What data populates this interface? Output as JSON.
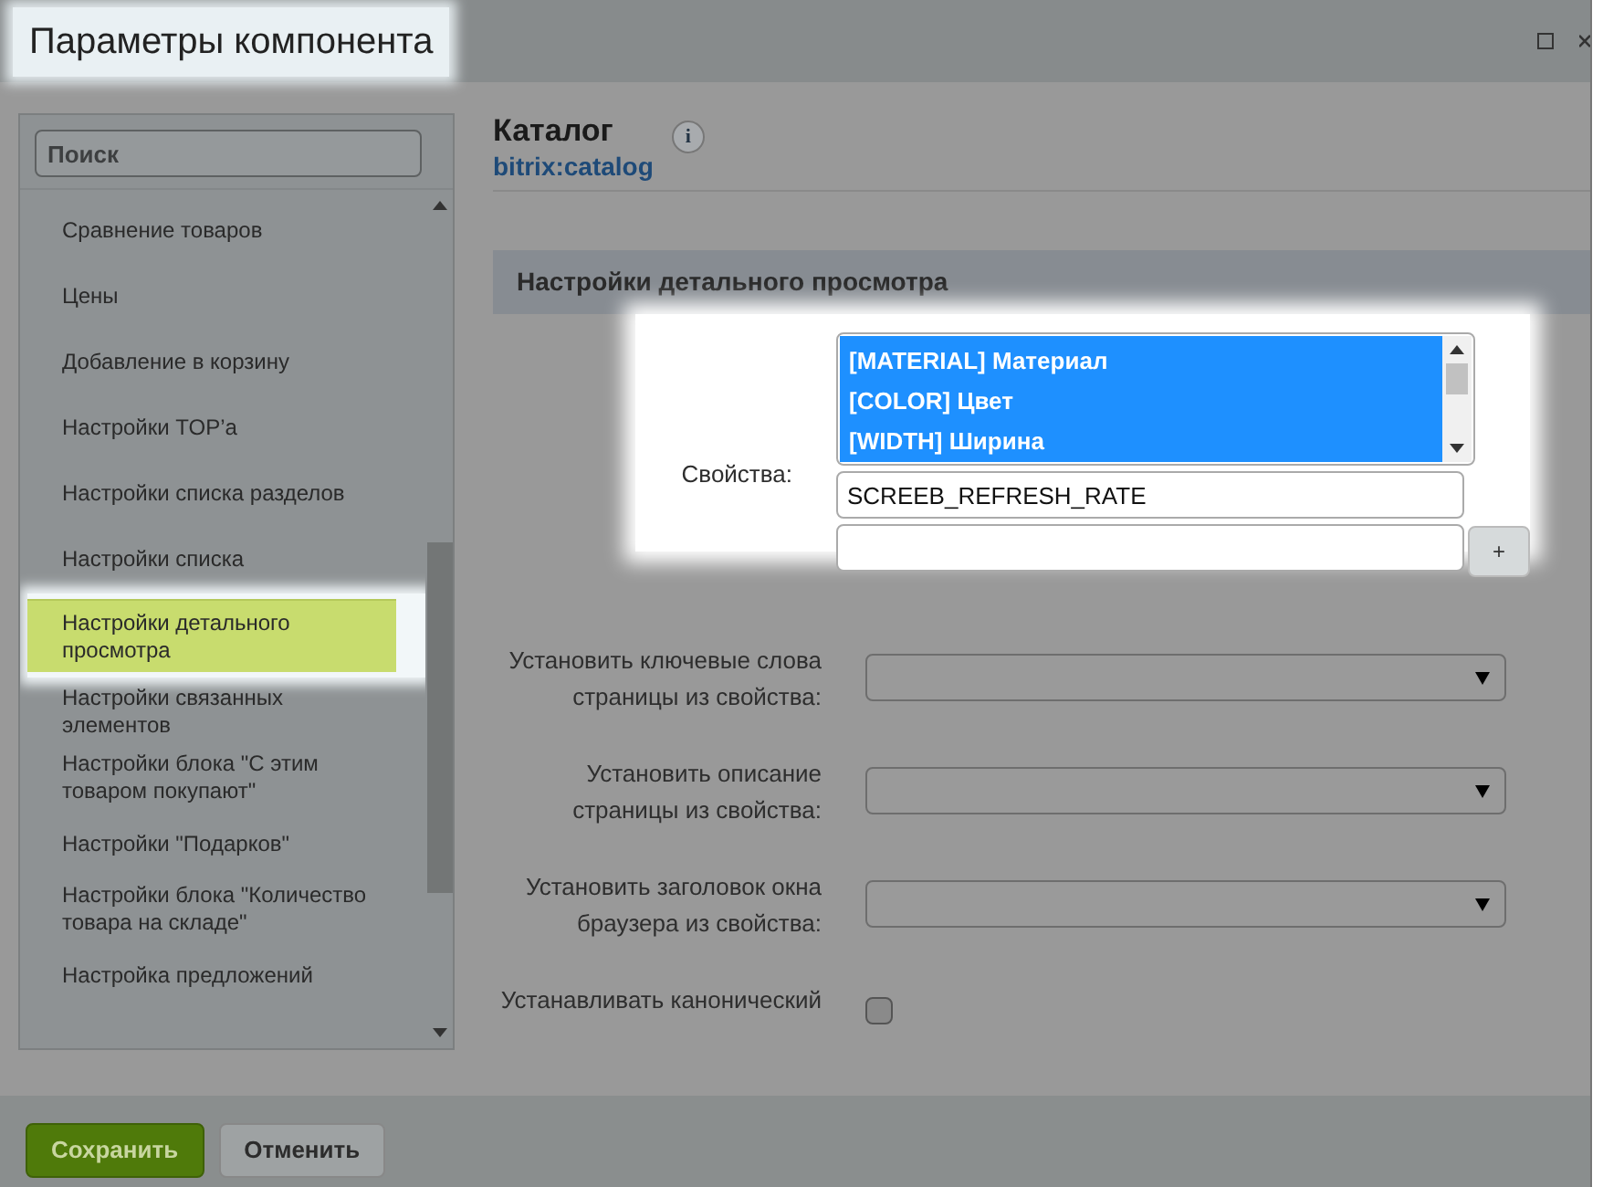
{
  "window": {
    "title": "Параметры компонента"
  },
  "sidebar": {
    "search": {
      "placeholder": "Поиск"
    },
    "items": [
      {
        "label": "Сравнение товаров",
        "selected": false
      },
      {
        "label": "Цены",
        "selected": false
      },
      {
        "label": "Добавление в корзину",
        "selected": false
      },
      {
        "label": "Настройки TOP’а",
        "selected": false
      },
      {
        "label": "Настройки списка разделов",
        "selected": false
      },
      {
        "label": "Настройки списка",
        "selected": false
      },
      {
        "label": "Настройки детального просмотра",
        "selected": true
      },
      {
        "label": "Настройки связанных элементов",
        "selected": false
      },
      {
        "label": "Настройки блока \"С этим товаром покупают\"",
        "selected": false
      },
      {
        "label": "Настройки \"Подарков\"",
        "selected": false
      },
      {
        "label": "Настройки блока \"Количество товара на складе\"",
        "selected": false
      },
      {
        "label": "Настройка предложений",
        "selected": false
      }
    ]
  },
  "component": {
    "title": "Каталог",
    "code": "bitrix:catalog",
    "info_button": "i"
  },
  "section": {
    "title": "Настройки детального просмотра"
  },
  "properties": {
    "label": "Свойства:",
    "options": [
      {
        "label": "[MATERIAL] Материал",
        "selected": true
      },
      {
        "label": "[COLOR] Цвет",
        "selected": true
      },
      {
        "label": "[WIDTH] Ширина",
        "selected": true
      }
    ],
    "inputs": [
      {
        "value": "SCREEB_REFRESH_RATE"
      }
    ],
    "add_button": "+"
  },
  "fields": [
    {
      "kind": "select",
      "label": "Установить ключевые слова страницы из свойства:"
    },
    {
      "kind": "select",
      "label": "Установить описание страницы из свойства:"
    },
    {
      "kind": "select",
      "label": "Установить заголовок окна браузера из свойства:"
    },
    {
      "kind": "checkbox",
      "label": "Устанавливать канонический",
      "checked": false
    }
  ],
  "footer": {
    "buttons": [
      {
        "label": "Сохранить",
        "kind": "primary"
      },
      {
        "label": "Отменить",
        "kind": "secondary"
      }
    ]
  }
}
